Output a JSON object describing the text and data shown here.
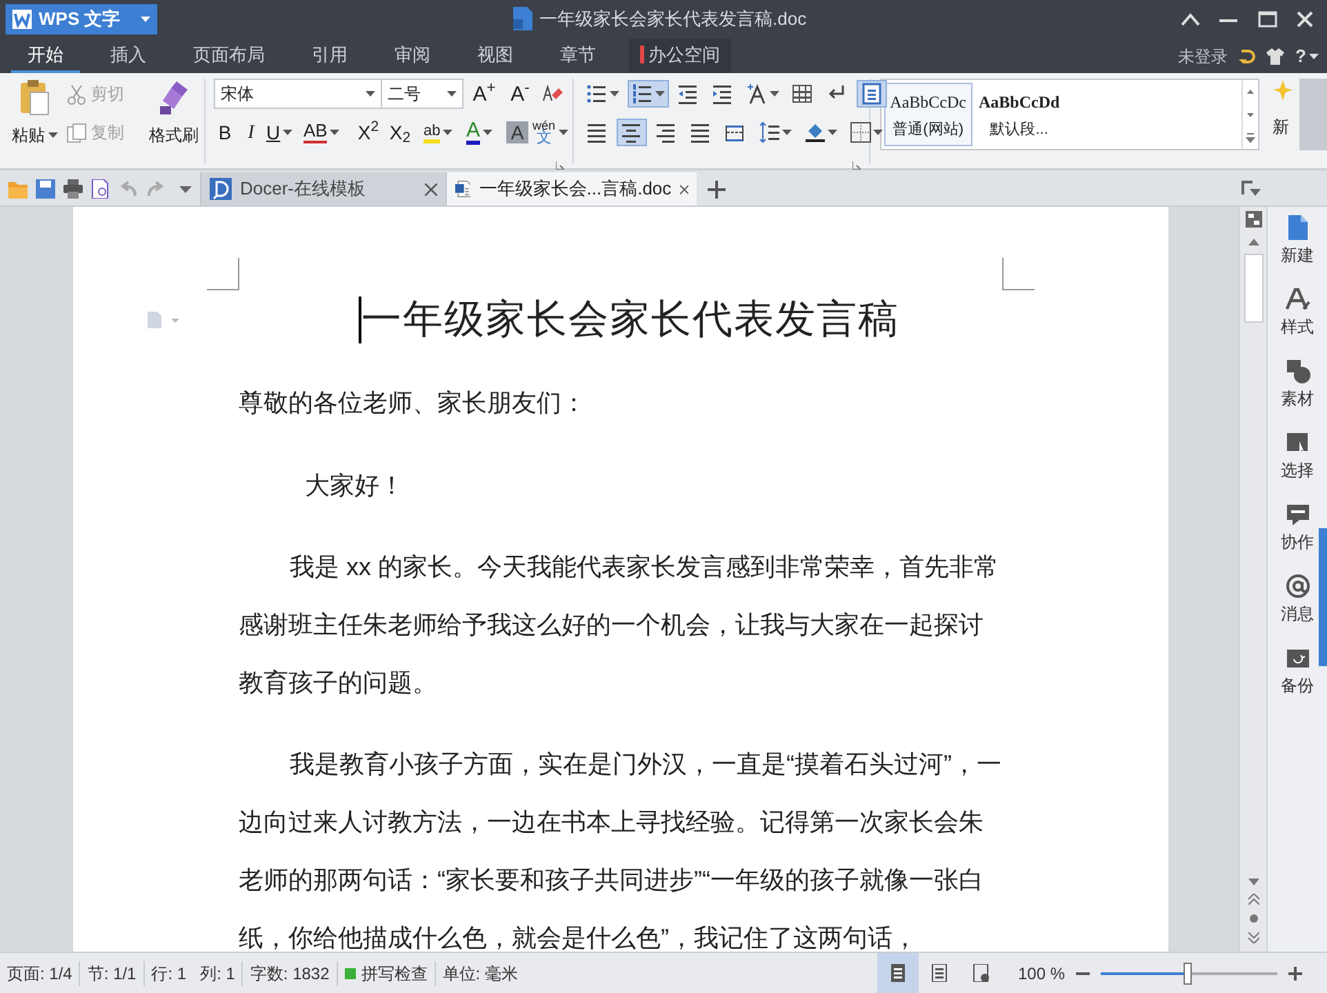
{
  "app_button": {
    "label": "WPS 文字"
  },
  "window": {
    "title": "一年级家长会家长代表发言稿.doc"
  },
  "menu_tabs": [
    {
      "label": "开始",
      "selected": true,
      "kind": "normal"
    },
    {
      "label": "插入",
      "selected": false,
      "kind": "normal"
    },
    {
      "label": "页面布局",
      "selected": false,
      "kind": "normal"
    },
    {
      "label": "引用",
      "selected": false,
      "kind": "normal"
    },
    {
      "label": "审阅",
      "selected": false,
      "kind": "normal"
    },
    {
      "label": "视图",
      "selected": false,
      "kind": "normal"
    },
    {
      "label": "章节",
      "selected": false,
      "kind": "normal"
    },
    {
      "label": "办公空间",
      "selected": false,
      "kind": "special"
    }
  ],
  "account": {
    "label": "未登录"
  },
  "help": {
    "label": "?"
  },
  "clipboard": {
    "paste": {
      "label": "粘贴"
    },
    "cut": {
      "label": "剪切",
      "disabled": true
    },
    "copy": {
      "label": "复制",
      "disabled": true
    },
    "format_painter": {
      "label": "格式刷"
    }
  },
  "font": {
    "family": "宋体",
    "size": "二号",
    "grow": "A$^{+}$",
    "shrink": "A$^{-}$"
  },
  "font_buttons": [
    {
      "kind": "bold",
      "label": "B"
    },
    {
      "kind": "italic",
      "label": "I"
    },
    {
      "kind": "underline",
      "label": "U"
    },
    {
      "kind": "strike",
      "label": "AB"
    },
    {
      "kind": "sup",
      "label": "X$^{2}$"
    },
    {
      "kind": "sub",
      "label": "X$_{2}$"
    },
    {
      "kind": "highlight",
      "label": "ab"
    },
    {
      "kind": "color",
      "label": "A"
    },
    {
      "kind": "shade",
      "label": "A"
    },
    {
      "kind": "phonetic",
      "label": "wén",
      "sub_label": "文"
    }
  ],
  "paragraph_buttons": [
    [
      {
        "kind": "bullets",
        "selected": false
      },
      {
        "kind": "numbering",
        "selected": true
      },
      {
        "kind": "outdent",
        "selected": false
      },
      {
        "kind": "indent",
        "selected": false
      },
      {
        "kind": "text_direction",
        "selected": false
      },
      {
        "kind": "table",
        "selected": false
      },
      {
        "kind": "para_mark",
        "selected": false
      },
      {
        "kind": "page_box",
        "selected": true
      }
    ],
    [
      {
        "kind": "align_left",
        "selected": false
      },
      {
        "kind": "align_center",
        "selected": true
      },
      {
        "kind": "align_right",
        "selected": false
      },
      {
        "kind": "justify",
        "selected": false
      },
      {
        "kind": "distribute",
        "selected": false
      },
      {
        "kind": "line_spacing",
        "selected": false
      },
      {
        "kind": "shading",
        "selected": false
      },
      {
        "kind": "borders",
        "selected": false
      }
    ]
  ],
  "styles": [
    {
      "sample": "AaBbCcDc",
      "label": "普通(网站)",
      "selected": true
    },
    {
      "sample": "AaBbCcDd",
      "label": "默认段...",
      "selected": false
    }
  ],
  "new_style": {
    "label": "新"
  },
  "doc_tabs": [
    {
      "label": "Docer-在线模板",
      "kind": "docer",
      "selected": false
    },
    {
      "label": "一年级家长会...言稿.doc",
      "kind": "doc",
      "selected": true
    }
  ],
  "document": {
    "title": "一年级家长会家长代表发言稿",
    "paragraphs": [
      {
        "kind": "salutation",
        "text": "尊敬的各位老师、家长朋友们："
      },
      {
        "kind": "greeting",
        "text": "大家好！"
      },
      {
        "kind": "body",
        "text": "我是 xx 的家长。今天我能代表家长发言感到非常荣幸，首先非常感谢班主任朱老师给予我这么好的一个机会，让我与大家在一起探讨教育孩子的问题。"
      },
      {
        "kind": "body",
        "text": "我是教育小孩子方面，实在是门外汉，一直是“摸着石头过河”，一边向过来人讨教方法，一边在书本上寻找经验。记得第一次家长会朱老师的那两句话：“家长要和孩子共同进步”“一年级的孩子就像一张白纸，你给他描成什么色，就会是什么色”，我记住了这两句话，"
      }
    ]
  },
  "sidebar": [
    {
      "kind": "new",
      "label": "新建"
    },
    {
      "kind": "style",
      "label": "样式"
    },
    {
      "kind": "material",
      "label": "素材"
    },
    {
      "kind": "select",
      "label": "选择"
    },
    {
      "kind": "collab",
      "label": "协作"
    },
    {
      "kind": "message",
      "label": "消息"
    },
    {
      "kind": "backup",
      "label": "备份"
    }
  ],
  "status_bar": {
    "items": [
      "页面: 1/4",
      "节: 1/1",
      "行: 1",
      "列: 1",
      "字数: 1832"
    ],
    "spell_check": {
      "label": "拼写检查",
      "on": true
    },
    "unit": "单位: 毫米",
    "views": [
      {
        "kind": "page",
        "selected": true
      },
      {
        "kind": "outline",
        "selected": false
      },
      {
        "kind": "web",
        "selected": false
      }
    ],
    "zoom": {
      "reading": "100 %",
      "level": 0.49
    }
  }
}
